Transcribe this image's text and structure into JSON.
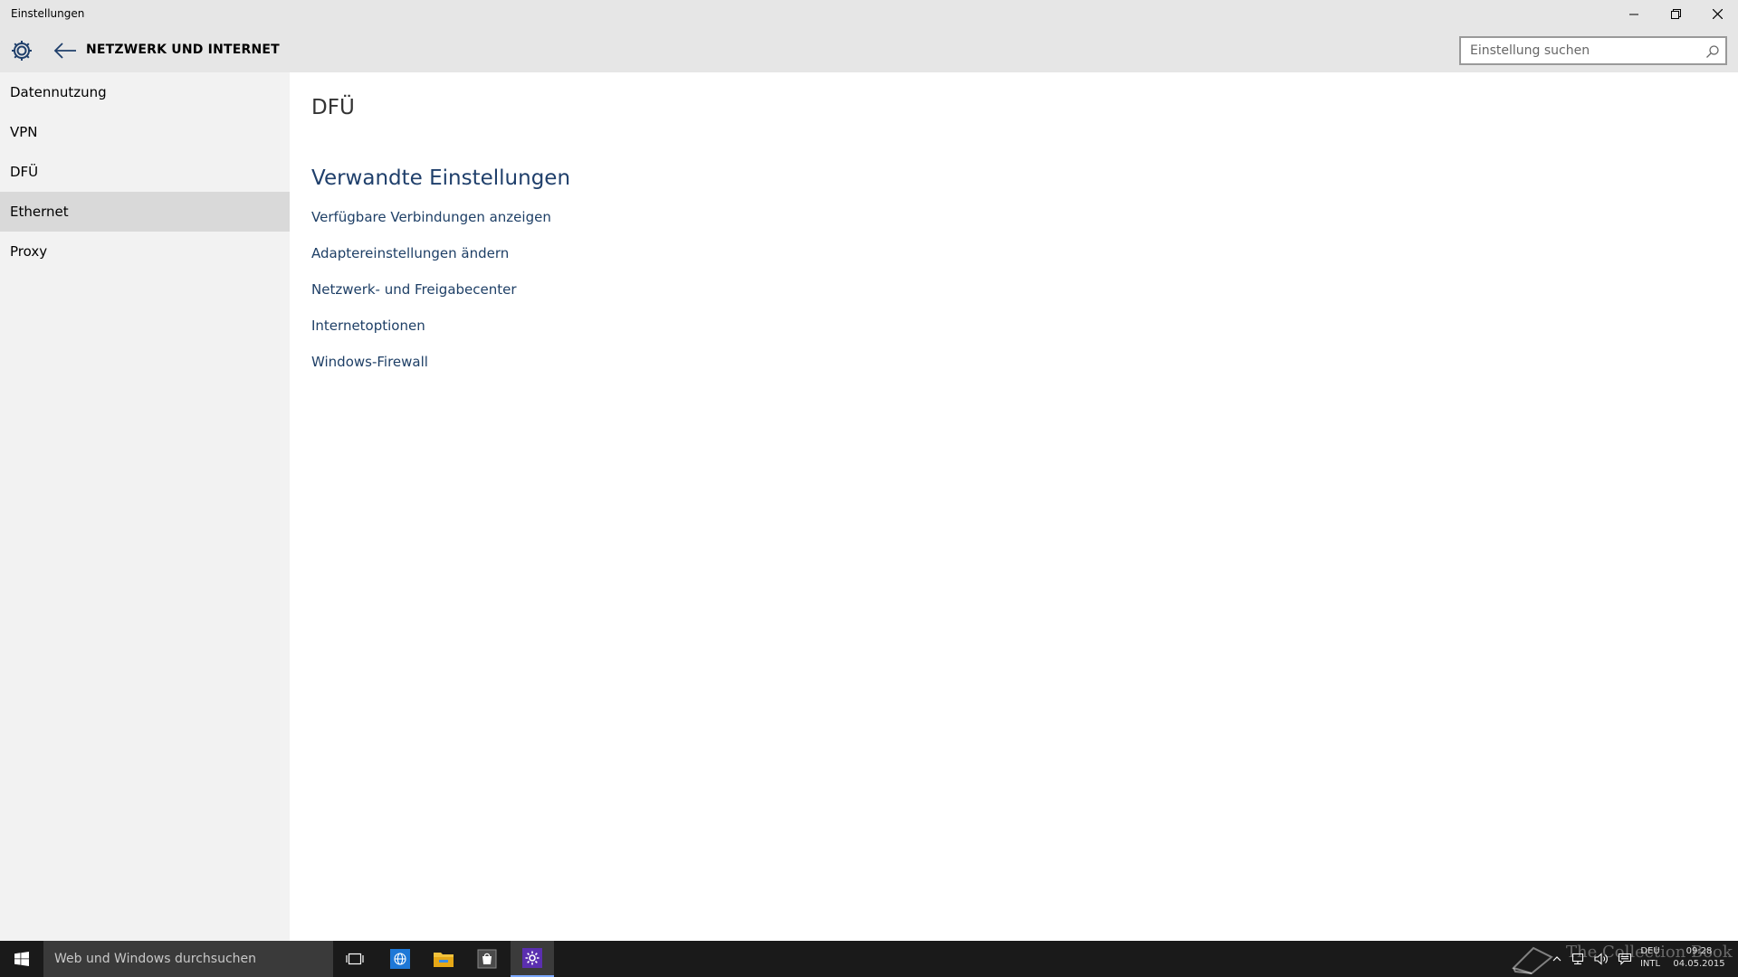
{
  "window": {
    "title": "Einstellungen"
  },
  "header": {
    "section_title": "NETZWERK UND INTERNET",
    "search_placeholder": "Einstellung suchen"
  },
  "sidebar": {
    "items": [
      {
        "label": "Datennutzung",
        "active": false
      },
      {
        "label": "VPN",
        "active": false
      },
      {
        "label": "DFÜ",
        "active": false
      },
      {
        "label": "Ethernet",
        "active": true
      },
      {
        "label": "Proxy",
        "active": false
      }
    ]
  },
  "main": {
    "page_title": "DFÜ",
    "related_title": "Verwandte Einstellungen",
    "links": [
      "Verfügbare Verbindungen anzeigen",
      "Adaptereinstellungen ändern",
      "Netzwerk- und Freigabecenter",
      "Internetoptionen",
      "Windows-Firewall"
    ]
  },
  "taskbar": {
    "search_placeholder": "Web und Windows durchsuchen",
    "apps": [
      "task-view-icon",
      "browser-icon",
      "file-explorer-icon",
      "store-icon",
      "settings-icon"
    ],
    "tray": {
      "language_top": "DEU",
      "language_bottom": "INTL",
      "time": "09:28",
      "date": "04.05.2015"
    },
    "watermark": "The Collection Book"
  },
  "colors": {
    "header_bg": "#e6e6e6",
    "sidebar_bg": "#f2f2f2",
    "active_item_bg": "#d9d9d9",
    "link_color": "#1e3f66",
    "taskbar_bg": "#1a1a1a"
  }
}
